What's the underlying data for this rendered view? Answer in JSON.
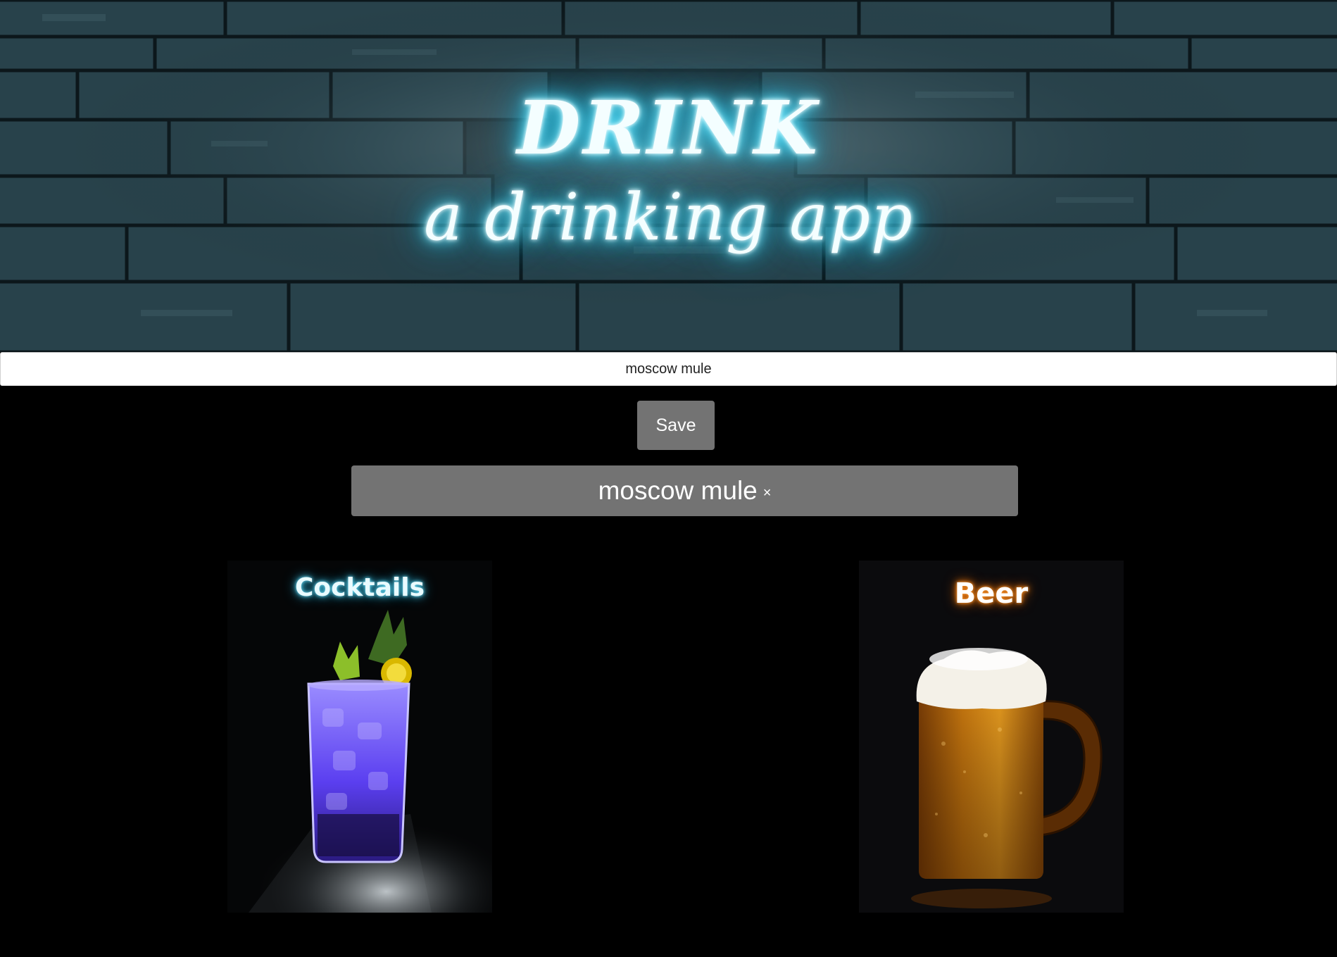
{
  "hero": {
    "title": "DRINK",
    "subtitle": "a drinking app"
  },
  "search": {
    "value": "moscow mule"
  },
  "save_button": {
    "label": "Save"
  },
  "saved_drinks": [
    {
      "label": "moscow mule",
      "close_glyph": "×"
    }
  ],
  "categories": [
    {
      "title": "Cocktails",
      "image": "cocktail-glass-image"
    },
    {
      "title": "Beer",
      "image": "beer-mug-image"
    }
  ],
  "colors": {
    "background": "#000000",
    "button": "#737373",
    "neon": "#3fd6f5",
    "stone_wall": "#1d3037"
  }
}
